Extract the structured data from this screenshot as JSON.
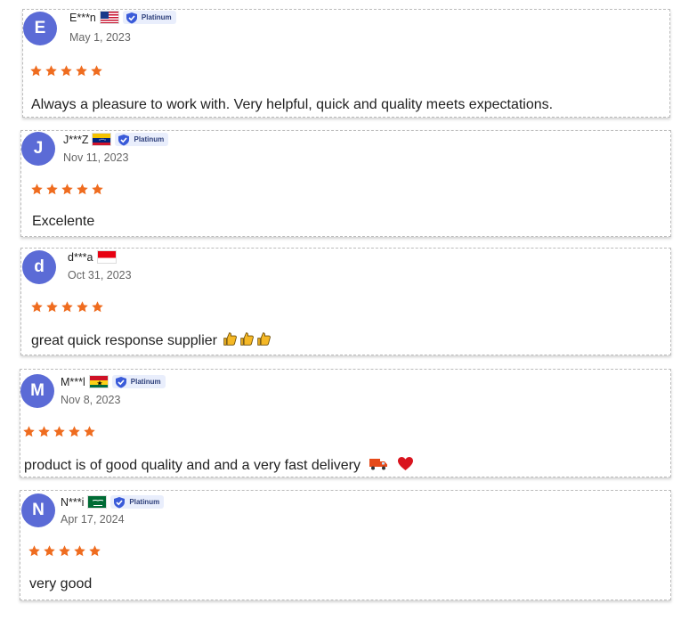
{
  "theme": {
    "avatar_color": "#5b6bd6",
    "star_color": "#ef6c1f",
    "badge_color": "#3a5bd9"
  },
  "reviews": [
    {
      "initial": "E",
      "name": "E***n",
      "country_flag": "us-flag",
      "badge": "Platinum",
      "date": "May 1, 2023",
      "rating": 5,
      "text": "Always a pleasure to work with. Very helpful, quick and quality meets expectations."
    },
    {
      "initial": "J",
      "name": "J***Z",
      "country_flag": "venezuela-flag",
      "badge": "Platinum",
      "date": "Nov 11, 2023",
      "rating": 5,
      "text": "Excelente"
    },
    {
      "initial": "d",
      "name": "d***a",
      "country_flag": "indonesia-flag",
      "badge": "",
      "date": "Oct 31, 2023",
      "rating": 5,
      "text": "great quick response supplier",
      "emojis": [
        "thumbs-up-icon",
        "thumbs-up-icon",
        "thumbs-up-icon"
      ]
    },
    {
      "initial": "M",
      "name": "M***l",
      "country_flag": "ghana-flag",
      "badge": "Platinum",
      "date": "Nov 8, 2023",
      "rating": 5,
      "text": "product is of good quality and and a very fast delivery",
      "emojis": [
        "delivery-truck-icon",
        "red-heart-icon"
      ]
    },
    {
      "initial": "N",
      "name": "N***i",
      "country_flag": "saudi-arabia-flag",
      "badge": "Platinum",
      "date": "Apr 17, 2024",
      "rating": 5,
      "text": "very good"
    }
  ]
}
